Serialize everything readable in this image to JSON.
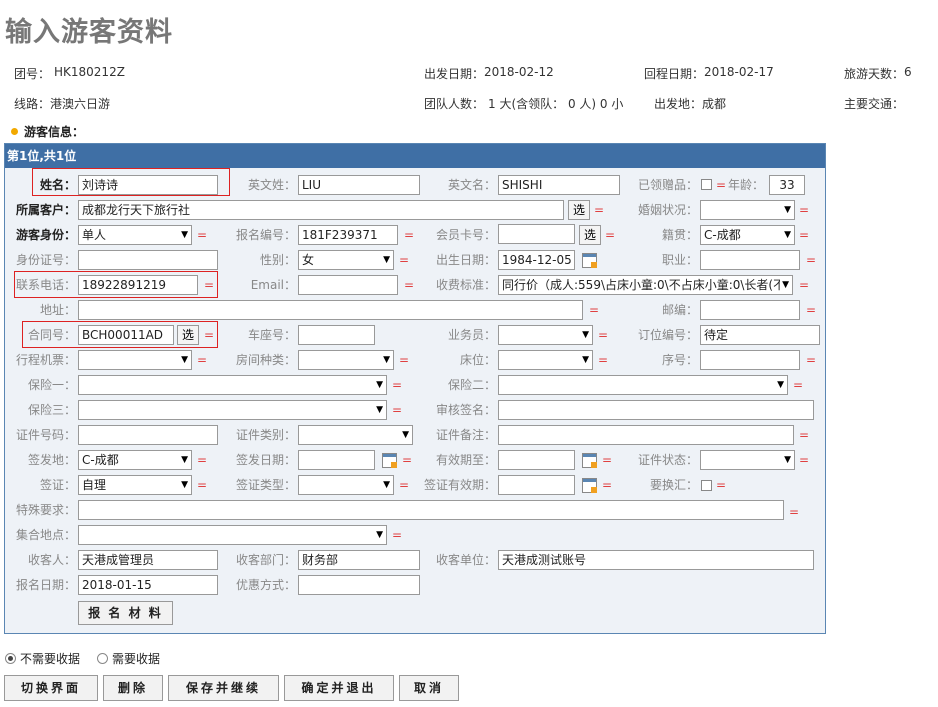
{
  "page_title": "输入游客资料",
  "group_info": {
    "tour_no_label": "团号：",
    "tour_no": "HK180212Z",
    "depart_date_label": "出发日期：",
    "depart_date": "2018-02-12",
    "return_date_label": "回程日期：",
    "return_date": "2018-02-17",
    "days_label": "旅游天数：",
    "days": "6",
    "route_label": "线路：",
    "route": "港澳六日游",
    "group_size_label": "团队人数：",
    "group_size": "1 大(含领队： 0 人) 0 小",
    "depart_place_label": "出发地：",
    "depart_place": "成都",
    "transport_label": "主要交通："
  },
  "section_label": "游客信息：",
  "panel_title": "第1位,共1位",
  "form": {
    "name_label": "姓名：",
    "name": "刘诗诗",
    "en_surname_label": "英文姓：",
    "en_surname": "LIU",
    "en_name_label": "英文名：",
    "en_name": "SHISHI",
    "gift_label": "已领赠品：",
    "age_label": "年龄：",
    "age": "33",
    "customer_label": "所属客户：",
    "customer": "成都龙行天下旅行社",
    "marital_label": "婚姻状况：",
    "marital": "",
    "identity_label": "游客身份：",
    "identity": "单人",
    "signup_no_label": "报名编号：",
    "signup_no": "181F239371",
    "member_card_label": "会员卡号：",
    "member_card": "",
    "origin_label": "籍贯：",
    "origin": "C-成都",
    "id_no_label": "身份证号：",
    "id_no": "",
    "gender_label": "性别：",
    "gender": "女",
    "birth_label": "出生日期：",
    "birth": "1984-12-05",
    "job_label": "职业：",
    "job": "",
    "phone_label": "联系电话：",
    "phone": "18922891219",
    "email_label": "Email：",
    "email": "",
    "fee_label": "收费标准：",
    "fee": "同行价（成人:559\\占床小童:0\\不占床小童:0\\长者(不",
    "address_label": "地址：",
    "address": "",
    "postcode_label": "邮编：",
    "postcode": "",
    "contract_label": "合同号：",
    "contract": "BCH00011AD",
    "seat_label": "车座号：",
    "seat": "",
    "salesman_label": "业务员：",
    "salesman": "",
    "order_no_label": "订位编号：",
    "order_no": "待定",
    "ticket_label": "行程机票：",
    "ticket": "",
    "room_label": "房间种类：",
    "room": "",
    "bed_label": "床位：",
    "bed": "",
    "seq_label": "序号：",
    "seq": "",
    "ins1_label": "保险一：",
    "ins1": "",
    "ins2_label": "保险二：",
    "ins2": "",
    "ins3_label": "保险三：",
    "ins3": "",
    "audit_label": "审核签名：",
    "audit": "",
    "cert_no_label": "证件号码：",
    "cert_no": "",
    "cert_type_label": "证件类别：",
    "cert_type": "",
    "cert_note_label": "证件备注：",
    "cert_note": "",
    "issue_place_label": "签发地：",
    "issue_place": "C-成都",
    "issue_date_label": "签发日期：",
    "issue_date": "",
    "valid_until_label": "有效期至：",
    "valid_until": "",
    "cert_status_label": "证件状态：",
    "cert_status": "",
    "visa_label": "签证：",
    "visa": "自理",
    "visa_type_label": "签证类型：",
    "visa_type": "",
    "visa_valid_label": "签证有效期：",
    "visa_valid": "",
    "exchange_label": "要换汇：",
    "special_label": "特殊要求：",
    "special": "",
    "meeting_label": "集合地点：",
    "meeting": "",
    "receiver_label": "收客人：",
    "receiver": "天港成管理员",
    "recv_dept_label": "收客部门：",
    "recv_dept": "财务部",
    "recv_unit_label": "收客单位：",
    "recv_unit": "天港成测试账号",
    "signup_date_label": "报名日期：",
    "signup_date": "2018-01-15",
    "discount_label": "优惠方式：",
    "discount": "",
    "select_btn": "选",
    "eq": "=",
    "materials_btn": "报 名 材 料"
  },
  "receipt": {
    "no_receipt": "不需要收据",
    "need_receipt": "需要收据",
    "selected": "no_receipt"
  },
  "actions": {
    "switch": "切换界面",
    "delete": "删除",
    "save_continue": "保存并继续",
    "confirm_exit": "确定并退出",
    "cancel": "取消"
  },
  "colors": {
    "panel_header": "#3f6fa5",
    "panel_bg": "#eef2f7",
    "required_eq": "#e04040",
    "highlight_box": "#d22222",
    "bullet": "#f2a900"
  }
}
